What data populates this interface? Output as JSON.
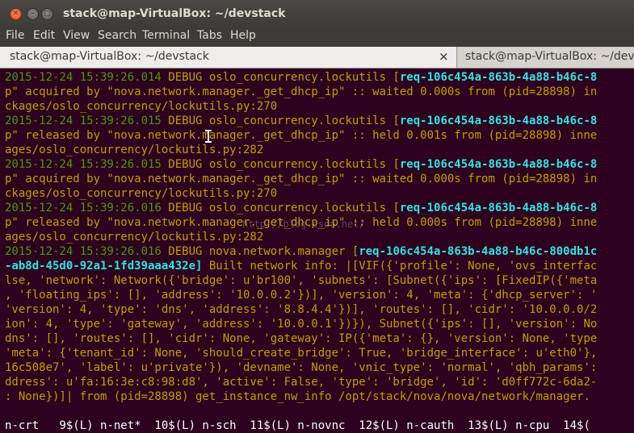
{
  "window": {
    "title": "stack@map-VirtualBox: ~/devstack"
  },
  "menu": {
    "items": [
      "File",
      "Edit",
      "View",
      "Search",
      "Terminal",
      "Tabs",
      "Help"
    ]
  },
  "tabs": [
    {
      "label": "stack@map-VirtualBox: ~/devstack",
      "active": true
    },
    {
      "label": "stack@map-VirtualBox: ~/devs",
      "active": false
    }
  ],
  "icons": {
    "close": "close-icon",
    "minimize": "minimize-icon",
    "maximize": "maximize-icon",
    "tab_close": "close-icon",
    "cursor": "text-cursor-icon"
  },
  "colors": {
    "background": "#2c001e",
    "green": "#4e9a06",
    "yellow": "#c4a000",
    "cyan": "#34e2e2",
    "white": "#d3d7cf"
  },
  "terminal": {
    "lines": [
      [
        {
          "c": "g",
          "t": "2015-12-24 15:39:26.014 "
        },
        {
          "c": "o",
          "t": "DEBUG oslo_concurrency.lockutils ["
        },
        {
          "c": "c",
          "t": "req-106c454a-863b-4a88-b46c-8"
        }
      ],
      [
        {
          "c": "o",
          "t": "p\" acquired by \"nova.network.manager._get_dhcp_ip\" :: waited 0.000s from (pid=28898) in"
        }
      ],
      [
        {
          "c": "o",
          "t": "ckages/oslo_concurrency/lockutils.py:270"
        }
      ],
      [
        {
          "c": "g",
          "t": "2015-12-24 15:39:26.015 "
        },
        {
          "c": "o",
          "t": "DEBUG oslo_concurrency.lockutils ["
        },
        {
          "c": "c",
          "t": "req-106c454a-863b-4a88-b46c-8"
        }
      ],
      [
        {
          "c": "o",
          "t": "p\" released by \"nova.network.manager._get_dhcp_ip\" :: held 0.001s from (pid=28898) inne"
        }
      ],
      [
        {
          "c": "o",
          "t": "ages/oslo_concurrency/lockutils.py:282"
        }
      ],
      [
        {
          "c": "g",
          "t": "2015-12-24 15:39:26.015 "
        },
        {
          "c": "o",
          "t": "DEBUG oslo_concurrency.lockutils ["
        },
        {
          "c": "c",
          "t": "req-106c454a-863b-4a88-b46c-8"
        }
      ],
      [
        {
          "c": "o",
          "t": "p\" acquired by \"nova.network.manager._get_dhcp_ip\" :: waited 0.000s from (pid=28898) in"
        }
      ],
      [
        {
          "c": "o",
          "t": "ckages/oslo_concurrency/lockutils.py:270"
        }
      ],
      [
        {
          "c": "g",
          "t": "2015-12-24 15:39:26.016 "
        },
        {
          "c": "o",
          "t": "DEBUG oslo_concurrency.lockutils ["
        },
        {
          "c": "c",
          "t": "req-106c454a-863b-4a88-b46c-8"
        }
      ],
      [
        {
          "c": "o",
          "t": "p\" released by \"nova.network.manager._get_dhcp_ip\" :: held 0.000s from (pid=28898) inne"
        }
      ],
      [
        {
          "c": "o",
          "t": "ages/oslo_concurrency/lockutils.py:282"
        }
      ],
      [
        {
          "c": "g",
          "t": "2015-12-24 15:39:26.016 "
        },
        {
          "c": "o",
          "t": "DEBUG nova.network.manager ["
        },
        {
          "c": "c",
          "t": "req-106c454a-863b-4a88-b46c-800db1c"
        }
      ],
      [
        {
          "c": "c",
          "t": "-ab8d-45d0-92a1-1fd39aaa432e] "
        },
        {
          "c": "o",
          "t": "Built network info: |[VIF({'profile': None, 'ovs_interfac"
        }
      ],
      [
        {
          "c": "o",
          "t": "lse, 'network': Network({'bridge': u'br100', 'subnets': [Subnet({'ips': [FixedIP({'meta"
        }
      ],
      [
        {
          "c": "o",
          "t": ", 'floating_ips': [], 'address': '10.0.0.2'})], 'version': 4, 'meta': {'dhcp_server': '"
        }
      ],
      [
        {
          "c": "o",
          "t": "'version': 4, 'type': 'dns', 'address': '8.8.4.4'})], 'routes': [], 'cidr': '10.0.0.0/2"
        }
      ],
      [
        {
          "c": "o",
          "t": "ion': 4, 'type': 'gateway', 'address': '10.0.0.1'})}), Subnet({'ips': [], 'version': No"
        }
      ],
      [
        {
          "c": "o",
          "t": "dns': [], 'routes': [], 'cidr': None, 'gateway': IP({'meta': {}, 'version': None, 'type"
        }
      ],
      [
        {
          "c": "o",
          "t": "'meta': {'tenant_id': None, 'should_create_bridge': True, 'bridge_interface': u'eth0'},"
        }
      ],
      [
        {
          "c": "o",
          "t": "16c508e7', 'label': u'private'}), 'devname': None, 'vnic_type': 'normal', 'qbh_params':"
        }
      ],
      [
        {
          "c": "o",
          "t": "ddress': u'fa:16:3e:c8:98:d8', 'active': False, 'type': 'bridge', 'id': 'd0ff772c-6da2-"
        }
      ],
      [
        {
          "c": "o",
          "t": ": None})]| from (pid=28898) get_instance_nw_info /opt/stack/nova/nova/network/manager."
        }
      ]
    ],
    "status_line": "n-crt   9$(L) n-net*  10$(L) n-sch  11$(L) n-novnc  12$(L) n-cauth  13$(L) n-cpu  14$(",
    "watermark": "http://blog.csdn.net/"
  }
}
